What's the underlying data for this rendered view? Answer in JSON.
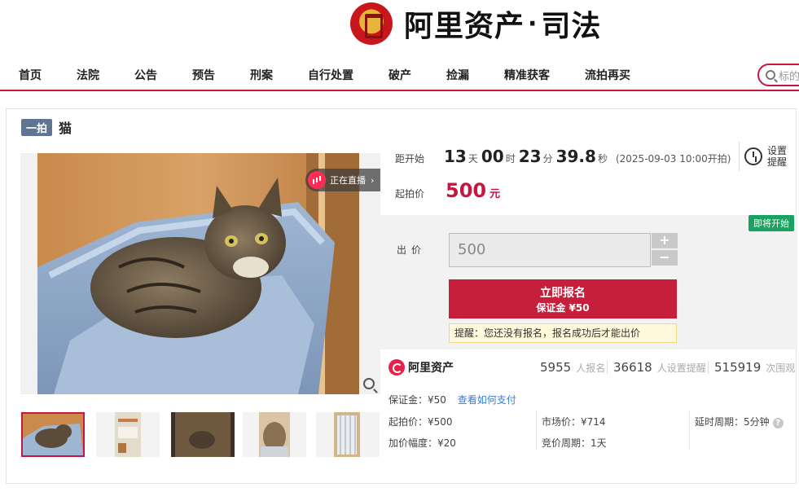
{
  "header": {
    "logo_text": "阿里资产",
    "logo_dot": "·",
    "logo_sub": "司法"
  },
  "nav": {
    "items": [
      "首页",
      "法院",
      "公告",
      "预告",
      "刑案",
      "自行处置",
      "破产",
      "捡漏",
      "精准获客",
      "流拍再买"
    ],
    "search_placeholder": "标的"
  },
  "item": {
    "badge": "一拍",
    "title": "猫"
  },
  "gallery": {
    "live_label": "正在直播",
    "live_arrow": "›"
  },
  "countdown": {
    "label": "距开始",
    "days": "13",
    "days_unit": "天",
    "hours": "00",
    "hours_unit": "时",
    "minutes": "23",
    "minutes_unit": "分",
    "seconds": "39.8",
    "seconds_unit": "秒",
    "start_note": "(2025-09-03 10:00开拍)"
  },
  "reminder": {
    "line1": "设置",
    "line2": "提醒"
  },
  "start_price": {
    "label": "起拍价",
    "value": "500",
    "unit": "元"
  },
  "bid": {
    "status_tag": "即将开始",
    "label": "出价",
    "input_value": "500",
    "plus": "+",
    "minus": "−",
    "signup_label": "立即报名",
    "deposit_label": "保证金 ¥50",
    "hint": "提醒：您还没有报名，报名成功后才能出价"
  },
  "stats": {
    "brand": "阿里资产",
    "signups": "5955",
    "signups_label": "人报名",
    "reminders": "36618",
    "reminders_label": "人设置提醒",
    "views": "515919",
    "views_label": "次围观"
  },
  "details": {
    "deposit": "保证金：¥50",
    "pay_link": "查看如何支付",
    "start_price": "起拍价：¥500",
    "market_price": "市场价：¥714",
    "delay_period": "延时周期：5分钟",
    "increment": "加价幅度：¥20",
    "bid_period": "竞价周期：1天"
  },
  "colors": {
    "accent": "#c7163f",
    "button": "#c51f3c",
    "status_green": "#1aa260",
    "link": "#3a7bd5"
  }
}
